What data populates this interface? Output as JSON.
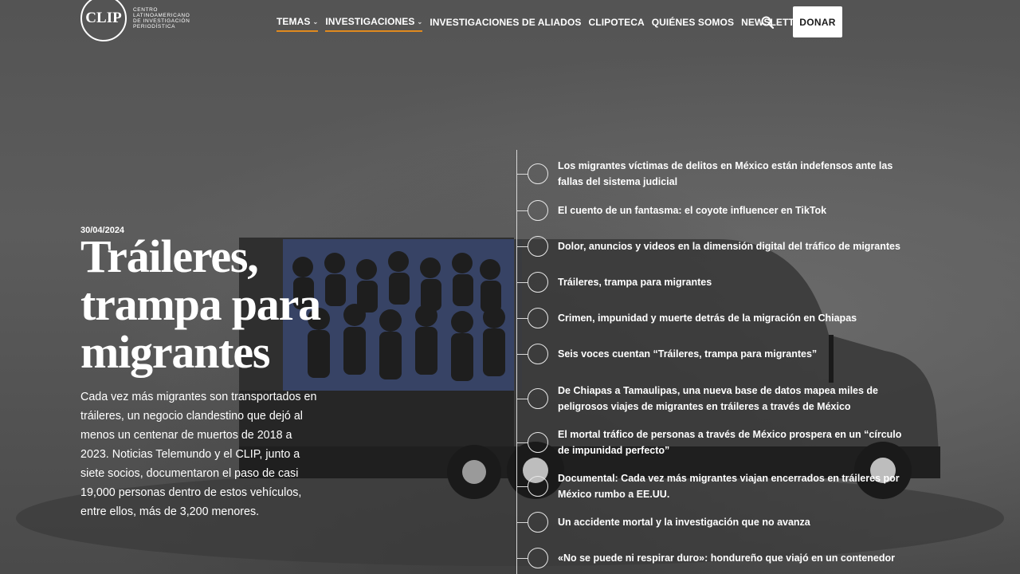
{
  "logo": {
    "mark": "CLIP",
    "text": "Centro Latinoamericano de Investigación Periodística"
  },
  "nav": {
    "items": [
      {
        "label": "TEMAS",
        "dropdown": true,
        "active": true
      },
      {
        "label": "INVESTIGACIONES",
        "dropdown": true,
        "active": true
      },
      {
        "label": "INVESTIGACIONES DE ALIADOS",
        "dropdown": false,
        "active": false
      },
      {
        "label": "CLIPOTECA",
        "dropdown": false,
        "active": false
      },
      {
        "label": "QUIÉNES SOMOS",
        "dropdown": false,
        "active": false
      },
      {
        "label": "NEWSLETTERS",
        "dropdown": false,
        "active": false
      }
    ],
    "search_icon": "search-icon",
    "donate_label": "DONAR"
  },
  "hero": {
    "date": "30/04/2024",
    "title": "Tráileres, trampa para migrantes",
    "lede": "Cada vez más migrantes son transportados en tráileres, un negocio clandestino que dejó al menos un centenar de muertos de 2018 a 2023. Noticias Telemundo y el CLIP, junto a siete socios, documentaron el paso de casi 19,000 personas dentro de estos vehículos, entre ellos, más de 3,200 menores."
  },
  "timeline": {
    "items": [
      "Los migrantes víctimas de delitos en México están indefensos ante las fallas del sistema judicial",
      "El cuento de un fantasma: el coyote influencer en TikTok",
      "Dolor, anuncios y videos en la dimensión digital del tráfico de migrantes",
      "Tráileres, trampa para migrantes",
      "Crimen, impunidad y muerte detrás de la migración en Chiapas",
      "Seis voces cuentan “Tráileres, trampa para migrantes”",
      "De Chiapas a Tamaulipas, una nueva base de datos mapea miles de peligrosos viajes de migrantes en tráileres a través de México",
      "El mortal tráfico de personas a través de México prospera en un “círculo de impunidad perfecto”",
      "Documental: Cada vez más migrantes viajan encerrados en tráileres por México rumbo a EE.UU.",
      "Un accidente mortal y la investigación que no avanza",
      "«No se puede ni respirar duro»: hondureño que viajó en un contenedor"
    ]
  },
  "colors": {
    "accent": "#e08a1e",
    "background": "#5a5a5a",
    "text": "#ffffff"
  }
}
